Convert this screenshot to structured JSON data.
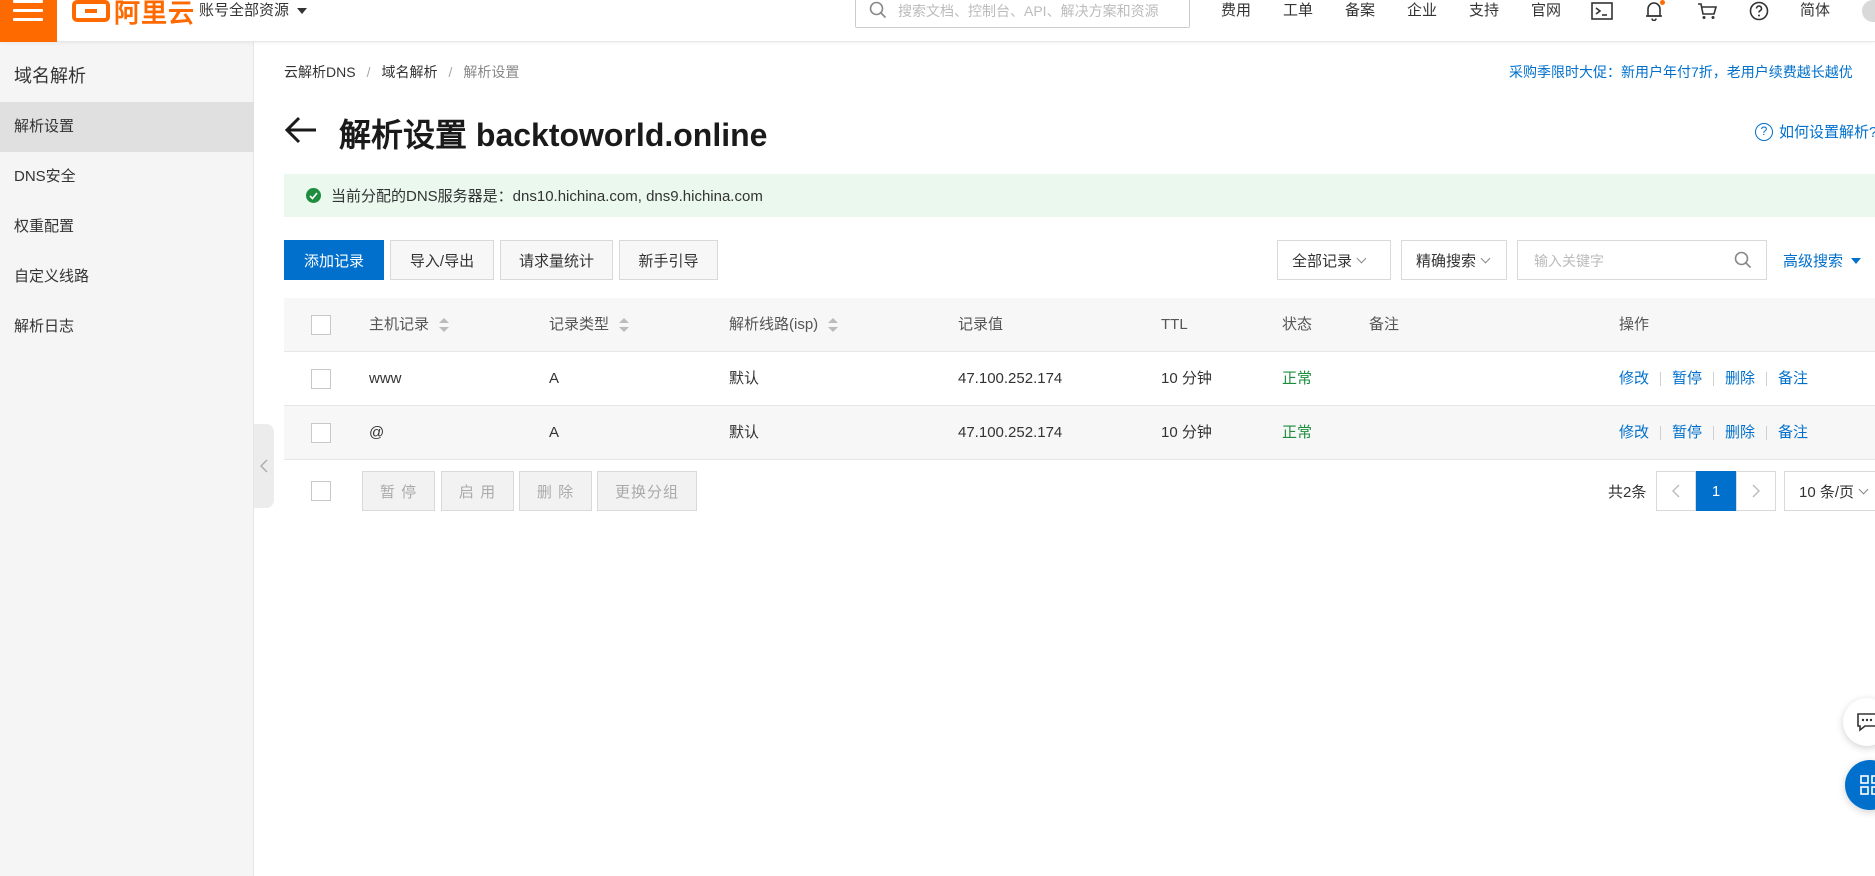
{
  "topbar": {
    "logo_text": "阿里云",
    "account_scope": "账号全部资源",
    "search_placeholder": "搜索文档、控制台、API、解决方案和资源",
    "nav_items": [
      "费用",
      "工单",
      "备案",
      "企业",
      "支持",
      "官网"
    ],
    "language": "简体",
    "icons": [
      "terminal-icon",
      "bell-icon",
      "cart-icon",
      "help-icon"
    ]
  },
  "sidebar": {
    "title": "域名解析",
    "items": [
      {
        "label": "解析设置",
        "active": true
      },
      {
        "label": "DNS安全"
      },
      {
        "label": "权重配置"
      },
      {
        "label": "自定义线路"
      },
      {
        "label": "解析日志"
      }
    ]
  },
  "breadcrumb": [
    "云解析DNS",
    "域名解析",
    "解析设置"
  ],
  "promo": "采购季限时大促：新用户年付7折，老用户续费越长越优",
  "page": {
    "title": "解析设置 backtoworld.online",
    "help_link": "如何设置解析?",
    "dns_notice": "当前分配的DNS服务器是：dns10.hichina.com, dns9.hichina.com"
  },
  "toolbar": {
    "add_record": "添加记录",
    "import_export": "导入/导出",
    "request_stats": "请求量统计",
    "beginner_guide": "新手引导",
    "record_filter": "全部记录",
    "search_mode": "精确搜索",
    "keyword_placeholder": "输入关键字",
    "advanced_search": "高级搜索"
  },
  "table": {
    "columns": [
      "主机记录",
      "记录类型",
      "解析线路(isp)",
      "记录值",
      "TTL",
      "状态",
      "备注",
      "操作"
    ],
    "rows": [
      {
        "host": "www",
        "type": "A",
        "line": "默认",
        "value": "47.100.252.174",
        "ttl": "10 分钟",
        "status": "正常",
        "remark": ""
      },
      {
        "host": "@",
        "type": "A",
        "line": "默认",
        "value": "47.100.252.174",
        "ttl": "10 分钟",
        "status": "正常",
        "remark": ""
      }
    ],
    "row_actions": [
      "修改",
      "暂停",
      "删除",
      "备注"
    ]
  },
  "bulk_actions": [
    "暂 停",
    "启 用",
    "删 除",
    "更换分组"
  ],
  "pagination": {
    "total": "共2条",
    "current_page": "1",
    "page_size": "10 条/页"
  },
  "colors": {
    "brand": "#ff6a00",
    "primary": "#0070cc",
    "success": "#1e8e3e",
    "notice_bg": "#eaf8ee"
  }
}
